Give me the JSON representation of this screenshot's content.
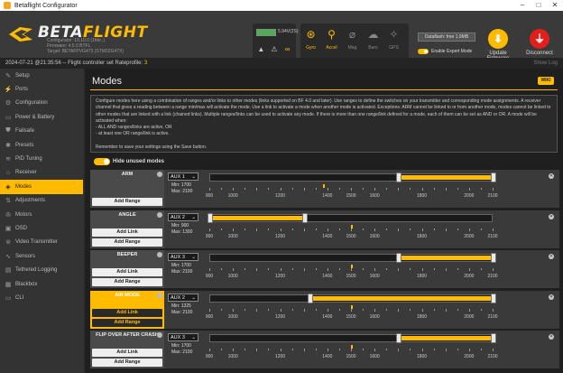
{
  "window": {
    "title": "Betaflight Configurator",
    "controls": [
      "–",
      "□",
      "✕"
    ]
  },
  "header": {
    "logo_main": "BETA",
    "logo_accent": "FLIGHT",
    "configurator_line": "Configurator: 10.10.0 (1fde..)",
    "firmware_line": "Firmware: 4.5.0 BTFL",
    "target_line": "Target: BETAFPVG473 (STM32G47X)",
    "battery_text": "5.94V(2S)",
    "sensors": [
      {
        "label": "Gyro",
        "icon": "gyro-icon",
        "glyph": "⊛",
        "on": true
      },
      {
        "label": "Accel",
        "icon": "accel-icon",
        "glyph": "⚲",
        "on": true
      },
      {
        "label": "Mag",
        "icon": "mag-icon",
        "glyph": "⌀",
        "on": false
      },
      {
        "label": "Baro",
        "icon": "baro-icon",
        "glyph": "☁",
        "on": false
      },
      {
        "label": "GPS",
        "icon": "gps-icon",
        "glyph": "✧",
        "on": false
      }
    ],
    "dataflash": "Dataflash: free 1.9MB",
    "expert_mode": "Enable Expert Mode",
    "update_firmware": "Update\nFirmware",
    "disconnect": "Disconnect"
  },
  "status": {
    "timestamp": "2024-07-21 @21:35:56",
    "message": " -- Flight controller set Rateprofile: ",
    "value": "3",
    "show_log": "Show Log"
  },
  "sidebar": [
    {
      "label": "Setup",
      "icon": "wrench-icon",
      "glyph": "✎"
    },
    {
      "label": "Ports",
      "icon": "plug-icon",
      "glyph": "⚡"
    },
    {
      "label": "Configuration",
      "icon": "gear-icon",
      "glyph": "⚙"
    },
    {
      "label": "Power & Battery",
      "icon": "battery-icon",
      "glyph": "▭"
    },
    {
      "label": "Failsafe",
      "icon": "failsafe-icon",
      "glyph": "⛊"
    },
    {
      "label": "Presets",
      "icon": "presets-icon",
      "glyph": "✱"
    },
    {
      "label": "PID Tuning",
      "icon": "pid-icon",
      "glyph": "≋"
    },
    {
      "label": "Receiver",
      "icon": "receiver-icon",
      "glyph": "⌂"
    },
    {
      "label": "Modes",
      "icon": "modes-icon",
      "glyph": "◈"
    },
    {
      "label": "Adjustments",
      "icon": "adjustments-icon",
      "glyph": "⇅"
    },
    {
      "label": "Motors",
      "icon": "motors-icon",
      "glyph": "✇"
    },
    {
      "label": "OSD",
      "icon": "osd-icon",
      "glyph": "▣"
    },
    {
      "label": "Video Transmitter",
      "icon": "vtx-icon",
      "glyph": "⊚"
    },
    {
      "label": "Sensors",
      "icon": "sensors-icon",
      "glyph": "∿"
    },
    {
      "label": "Tethered Logging",
      "icon": "logging-icon",
      "glyph": "▤"
    },
    {
      "label": "Blackbox",
      "icon": "blackbox-icon",
      "glyph": "▦"
    },
    {
      "label": "CLI",
      "icon": "cli-icon",
      "glyph": "▭"
    }
  ],
  "main": {
    "title": "Modes",
    "wiki": "WIKI",
    "note": [
      "Configure modes here using a combination of ranges and/or links to other modes (links supported on BF 4.0 and later). Use ranges to define the switches on your transmitter and corresponding mode assignments. A receiver channel that gives a reading between a range min/max will activate the mode. Use a link to activate a mode when another mode is activated. Exceptions: ARM cannot be linked to or from another mode, modes cannot be linked to other modes that are linked with a link (chained links). Multiple ranges/links can be used to activate any mode. If there is more than one range/link defined for a mode, each of them can be set as AND or OR. A mode will be activated when:",
      "- ALL AND ranges/links are active, OR",
      "- at least one OR range/link is active.",
      "",
      "Remember to save your settings using the Save button."
    ],
    "hide_unused": "Hide unused modes",
    "scale_labels": [
      "900",
      "1000",
      "1200",
      "1400",
      "1500",
      "1600",
      "1800",
      "2000",
      "2100"
    ],
    "modes": [
      {
        "name": "ARM",
        "aux": "AUX 1",
        "min": "Min: 1700",
        "max": "Max: 2100",
        "buttons": [
          "Add Range"
        ],
        "active": false,
        "range": [
          1700,
          2100
        ],
        "marker": 1380
      },
      {
        "name": "ANGLE",
        "aux": "AUX 2",
        "min": "Min: 900",
        "max": "Max: 1300",
        "buttons": [
          "Add Link",
          "Add Range"
        ],
        "active": false,
        "range": [
          900,
          1300
        ],
        "marker": 1500
      },
      {
        "name": "BEEPER",
        "aux": "AUX 3",
        "min": "Min: 1700",
        "max": "Max: 2100",
        "buttons": [
          "Add Link",
          "Add Range"
        ],
        "active": false,
        "range": [
          1700,
          2100
        ],
        "marker": 1500
      },
      {
        "name": "AIR MODE",
        "aux": "AUX 2",
        "min": "Min: 1325",
        "max": "Max: 2100",
        "buttons": [
          "Add Link",
          "Add Range"
        ],
        "active": true,
        "range": [
          1325,
          2100
        ],
        "marker": 1500
      },
      {
        "name": "FLIP OVER AFTER CRASH",
        "aux": "AUX 3",
        "min": "Min: 1700",
        "max": "Max: 2100",
        "buttons": [
          "Add Link",
          "Add Range"
        ],
        "active": false,
        "range": [
          1700,
          2100
        ],
        "marker": 1500
      }
    ]
  }
}
